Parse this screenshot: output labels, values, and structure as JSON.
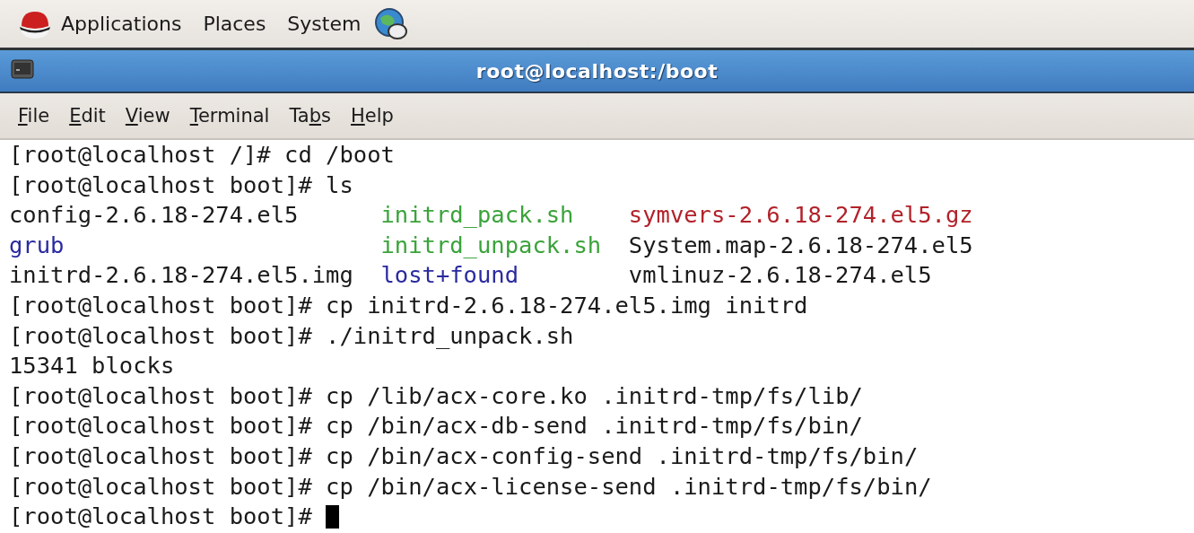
{
  "panel": {
    "menus": [
      "Applications",
      "Places",
      "System"
    ]
  },
  "window": {
    "title": "root@localhost:/boot"
  },
  "menubar": [
    {
      "mnemonic": "F",
      "after": "ile"
    },
    {
      "mnemonic": "E",
      "after": "dit"
    },
    {
      "mnemonic": "V",
      "after": "iew"
    },
    {
      "mnemonic": "T",
      "after": "erminal"
    },
    {
      "before": "Ta",
      "mnemonic": "b",
      "after": "s"
    },
    {
      "mnemonic": "H",
      "after": "elp"
    }
  ],
  "terminal": {
    "lines": [
      {
        "kind": "text",
        "text": "[root@localhost /]# cd /boot",
        "cursor": false
      },
      {
        "kind": "text",
        "text": "[root@localhost boot]# ls",
        "cursor": false
      },
      {
        "kind": "listing",
        "entries": [
          {
            "name": "config-2.6.18-274.el5",
            "color": "#1a1a1a"
          },
          {
            "name": "initrd_pack.sh",
            "color": "#3aa33a"
          },
          {
            "name": "symvers-2.6.18-274.el5.gz",
            "color": "#b2222a"
          }
        ]
      },
      {
        "kind": "listing",
        "entries": [
          {
            "name": "grub",
            "color": "#2a2aa0"
          },
          {
            "name": "initrd_unpack.sh",
            "color": "#3aa33a"
          },
          {
            "name": "System.map-2.6.18-274.el5",
            "color": "#1a1a1a"
          }
        ]
      },
      {
        "kind": "listing",
        "entries": [
          {
            "name": "initrd-2.6.18-274.el5.img",
            "color": "#1a1a1a"
          },
          {
            "name": "lost+found",
            "color": "#2a2aa0"
          },
          {
            "name": "vmlinuz-2.6.18-274.el5",
            "color": "#1a1a1a"
          }
        ]
      },
      {
        "kind": "text",
        "text": "[root@localhost boot]# cp initrd-2.6.18-274.el5.img initrd",
        "cursor": false
      },
      {
        "kind": "text",
        "text": "[root@localhost boot]# ./initrd_unpack.sh",
        "cursor": false
      },
      {
        "kind": "text",
        "text": "15341 blocks",
        "cursor": false
      },
      {
        "kind": "text",
        "text": "[root@localhost boot]# cp /lib/acx-core.ko .initrd-tmp/fs/lib/",
        "cursor": false
      },
      {
        "kind": "text",
        "text": "[root@localhost boot]# cp /bin/acx-db-send .initrd-tmp/fs/bin/",
        "cursor": false
      },
      {
        "kind": "text",
        "text": "[root@localhost boot]# cp /bin/acx-config-send .initrd-tmp/fs/bin/",
        "cursor": false
      },
      {
        "kind": "text",
        "text": "[root@localhost boot]# cp /bin/acx-license-send .initrd-tmp/fs/bin/",
        "cursor": false
      },
      {
        "kind": "text",
        "text": "[root@localhost boot]#",
        "cursor": true
      }
    ]
  }
}
